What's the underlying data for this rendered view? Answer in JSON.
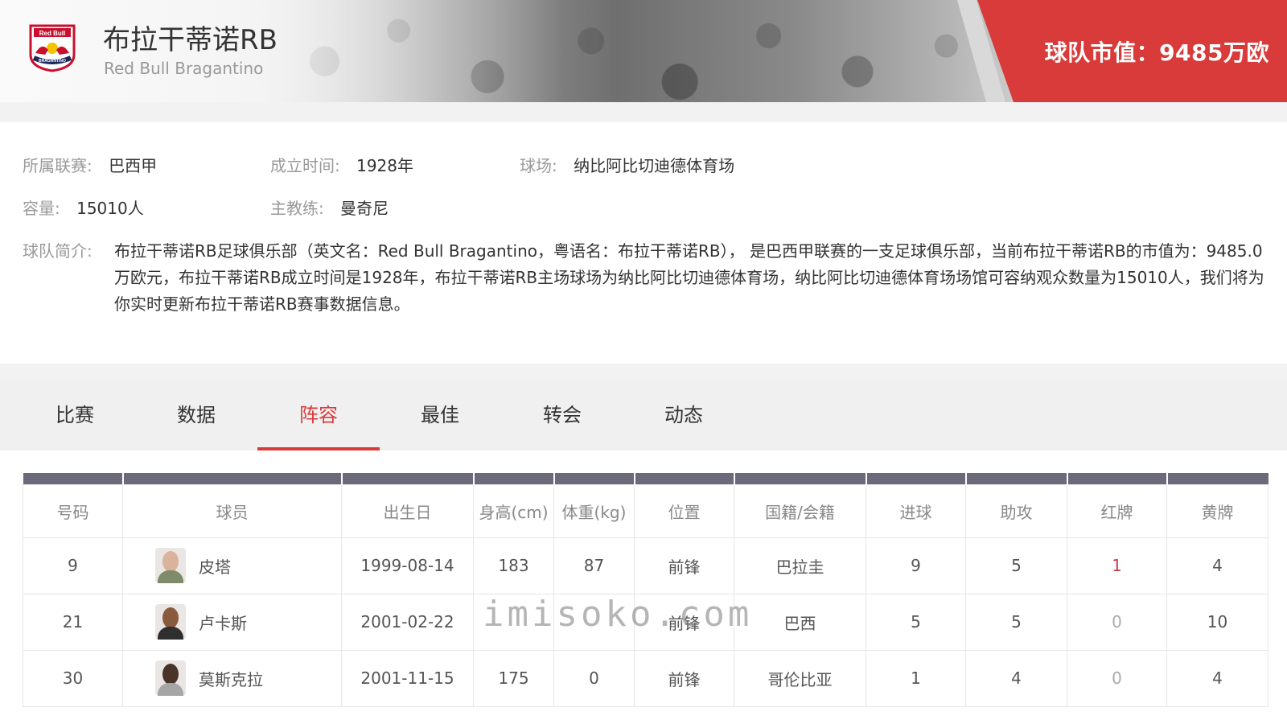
{
  "header": {
    "team_name": "布拉干蒂诺RB",
    "team_name_en": "Red Bull Bragantino",
    "market_value": "球队市值：9485万欧",
    "logo_text_top": "Red Bull",
    "logo_text_bottom": "BRAGANTINO",
    "accent_color": "#d93a3a"
  },
  "info": {
    "league_label": "所属联赛:",
    "league_value": "巴西甲",
    "founded_label": "成立时间:",
    "founded_value": "1928年",
    "stadium_label": "球场:",
    "stadium_value": "纳比阿比切迪德体育场",
    "capacity_label": "容量:",
    "capacity_value": "15010人",
    "coach_label": "主教练:",
    "coach_value": "曼奇尼",
    "intro_label": "球队简介:",
    "intro_text": "布拉干蒂诺RB足球俱乐部（英文名：Red Bull Bragantino，粤语名：布拉干蒂诺RB）， 是巴西甲联赛的一支足球俱乐部，当前布拉干蒂诺RB的市值为：9485.0万欧元，布拉干蒂诺RB成立时间是1928年，布拉干蒂诺RB主场球场为纳比阿比切迪德体育场，纳比阿比切迪德体育场场馆可容纳观众数量为15010人，我们将为你实时更新布拉干蒂诺RB赛事数据信息。"
  },
  "tabs": [
    {
      "label": "比赛",
      "active": false
    },
    {
      "label": "数据",
      "active": false
    },
    {
      "label": "阵容",
      "active": true
    },
    {
      "label": "最佳",
      "active": false
    },
    {
      "label": "转会",
      "active": false
    },
    {
      "label": "动态",
      "active": false
    }
  ],
  "table": {
    "headers": [
      "号码",
      "球员",
      "出生日",
      "身高(cm)",
      "体重(kg)",
      "位置",
      "国籍/会籍",
      "进球",
      "助攻",
      "红牌",
      "黄牌"
    ],
    "rows": [
      {
        "number": "9",
        "name": "皮塔",
        "birth": "1999-08-14",
        "height": "183",
        "weight": "87",
        "position": "前锋",
        "nationality": "巴拉圭",
        "goals": "9",
        "assists": "5",
        "red": "1",
        "yellow": "4"
      },
      {
        "number": "21",
        "name": "卢卡斯",
        "birth": "2001-02-22",
        "height": "",
        "weight": "",
        "position": "前锋",
        "nationality": "巴西",
        "goals": "5",
        "assists": "5",
        "red": "0",
        "yellow": "10"
      },
      {
        "number": "30",
        "name": "莫斯克拉",
        "birth": "2001-11-15",
        "height": "175",
        "weight": "0",
        "position": "前锋",
        "nationality": "哥伦比亚",
        "goals": "1",
        "assists": "4",
        "red": "0",
        "yellow": "4"
      }
    ]
  },
  "watermark": "imisoko.com"
}
